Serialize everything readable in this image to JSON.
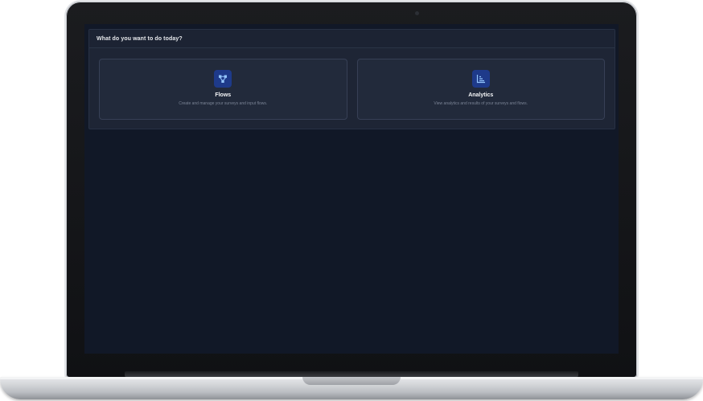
{
  "panel": {
    "title": "What do you want to do today?"
  },
  "cards": [
    {
      "title": "Flows",
      "description": "Create and manage your surveys and input flows.",
      "icon": "flow-nodes-icon"
    },
    {
      "title": "Analytics",
      "description": "View analytics and results of your surveys and flows.",
      "icon": "chart-icon"
    }
  ],
  "colors": {
    "background": "#111827",
    "panel": "#1e2535",
    "card": "#222a3b",
    "icon_bg": "#1e3a8a",
    "icon_fg": "#93c5fd"
  }
}
